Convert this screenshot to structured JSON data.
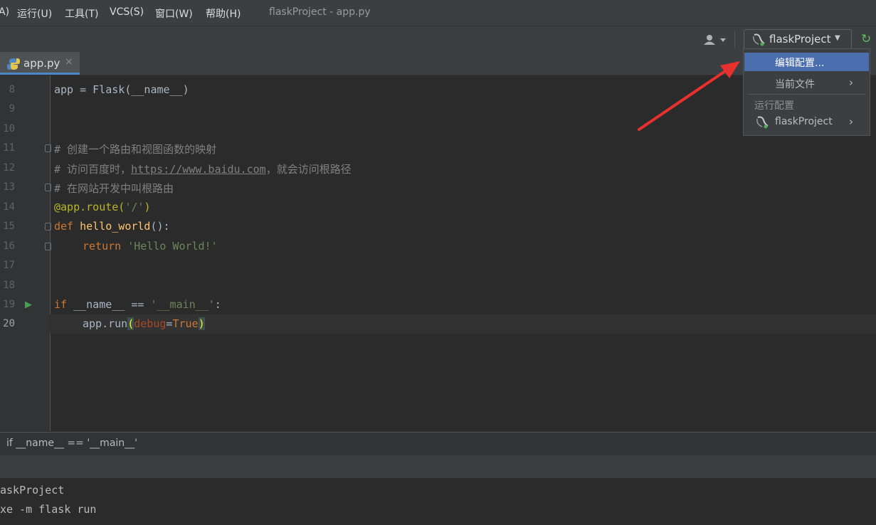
{
  "menu": {
    "partial_left": "A)",
    "items": [
      "运行(U)",
      "工具(T)",
      "VCS(S)",
      "窗口(W)",
      "帮助(H)"
    ],
    "title": "flaskProject - app.py"
  },
  "toolbar": {
    "run_config_label": "flaskProject"
  },
  "tab": {
    "filename": "app.py"
  },
  "editor": {
    "lines": [
      {
        "num": "8"
      },
      {
        "num": "9"
      },
      {
        "num": "10"
      },
      {
        "num": "11"
      },
      {
        "num": "12"
      },
      {
        "num": "13"
      },
      {
        "num": "14"
      },
      {
        "num": "15"
      },
      {
        "num": "16"
      },
      {
        "num": "17"
      },
      {
        "num": "18"
      },
      {
        "num": "19"
      },
      {
        "num": "20"
      }
    ],
    "t": {
      "l8_code": "app = Flask(__name__)",
      "l11": "# 创建一个路由和视图函数的映射",
      "l12_a": "# 访问百度时，",
      "l12_link": "https://www.baidu.com",
      "l12_b": "，就会访问根路径",
      "l13": "# 在网站开发中叫根路由",
      "l14_deco": "@app.route(",
      "l14_str": "'/'",
      "l14_close": ")",
      "l15_def": "def ",
      "l15_fn": "hello_world",
      "l15_rest": "():",
      "l16_ret": "return ",
      "l16_str": "'Hello World!'",
      "l19_if": "if ",
      "l19_mid": "__name__ == ",
      "l19_str": "'__main__'",
      "l19_end": ":",
      "l20_a": "app.run",
      "l20_open": "(",
      "l20_param": "debug",
      "l20_eq": "=",
      "l20_true": "True",
      "l20_close": ")"
    }
  },
  "breadcrumb": "if __name__ == '__main__'",
  "console": {
    "line1": "askProject",
    "line2": "xe -m flask run"
  },
  "dropdown": {
    "edit_config": "编辑配置...",
    "current_file": "当前文件",
    "group_label": "运行配置",
    "project": "flaskProject"
  },
  "colors": {
    "accent": "#4b6eaf",
    "arrow": "#e8312f"
  }
}
